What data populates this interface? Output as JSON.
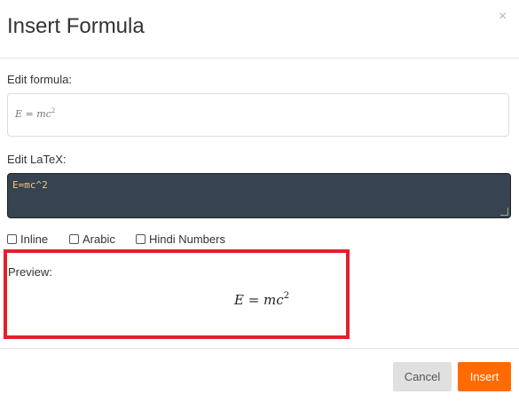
{
  "dialog": {
    "title": "Insert Formula",
    "close_glyph": "×"
  },
  "edit_formula": {
    "label": "Edit formula:",
    "rendered": {
      "lhs": "E = mc",
      "exponent": "2"
    }
  },
  "edit_latex": {
    "label": "Edit LaTeX:",
    "value": "E=mc^2"
  },
  "options": [
    {
      "label": "Inline",
      "checked": false
    },
    {
      "label": "Arabic",
      "checked": false
    },
    {
      "label": "Hindi Numbers",
      "checked": false
    }
  ],
  "preview": {
    "label": "Preview:",
    "lhs": "E = mc",
    "exponent": "2",
    "highlight_color": "#e3202a"
  },
  "footer": {
    "cancel_label": "Cancel",
    "insert_label": "Insert",
    "insert_color": "#ff6b00"
  }
}
